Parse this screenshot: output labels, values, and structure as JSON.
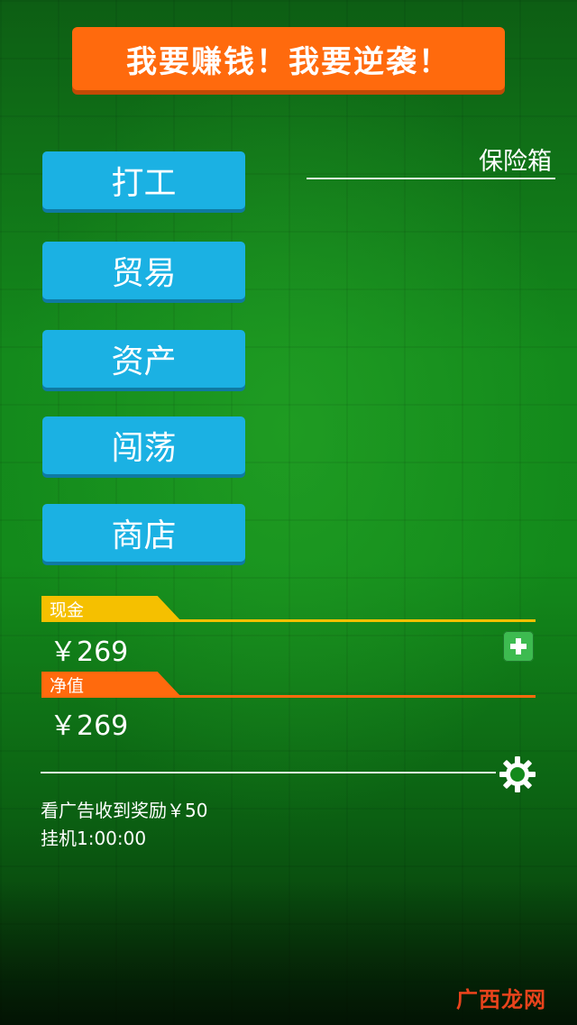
{
  "banner": {
    "title": "我要赚钱！我要逆袭！"
  },
  "menu": {
    "items": [
      {
        "label": "打工"
      },
      {
        "label": "贸易"
      },
      {
        "label": "资产"
      },
      {
        "label": "闯荡"
      },
      {
        "label": "商店"
      }
    ]
  },
  "safe": {
    "label": "保险箱"
  },
  "cash": {
    "tag": "现金",
    "amount": "￥269"
  },
  "net": {
    "tag": "净值",
    "amount": "￥269"
  },
  "info": {
    "ad_reward": "看广告收到奖励￥50",
    "idle": "挂机1:00:00"
  },
  "watermark": "广西龙网",
  "colors": {
    "banner": "#ff6a0d",
    "button": "#1bb1e3",
    "cash": "#f5c000",
    "net": "#ff6a0d",
    "plus": "#3dbb50"
  },
  "icons": {
    "plus": "plus-icon",
    "settings": "gear-icon"
  }
}
